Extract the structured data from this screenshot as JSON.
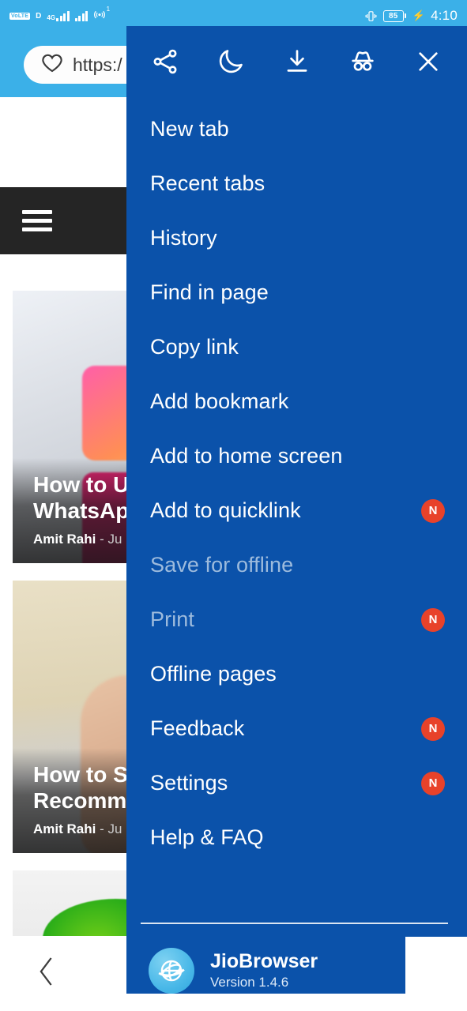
{
  "status_bar": {
    "volte_label": "VoLTE",
    "data_letter": "D",
    "network_label": "4G",
    "hotspot_sup": "1",
    "battery_level": "85",
    "time": "4:10",
    "icons": [
      "volte-icon",
      "signal-bars-icon",
      "signal-bars-icon",
      "hotspot-icon",
      "vibrate-icon",
      "battery-icon",
      "charging-bolt-icon"
    ]
  },
  "browser": {
    "url_text": "https:/",
    "favorite_icon": "heart-icon",
    "menu_icon": "hamburger-icon",
    "back_icon": "chevron-left-icon"
  },
  "articles": [
    {
      "title_line1": "How to U",
      "title_line2": "WhatsApp",
      "author": "Amit Rahi",
      "separator": "-",
      "date": "Ju"
    },
    {
      "title_line1": "How to S",
      "title_line2": "Recomme",
      "author": "Amit Rahi",
      "separator": "-",
      "date": "Ju"
    }
  ],
  "menu": {
    "top_icons": [
      {
        "name": "share-icon",
        "label": "Share"
      },
      {
        "name": "night-mode-icon",
        "label": "Night mode"
      },
      {
        "name": "downloads-icon",
        "label": "Downloads"
      },
      {
        "name": "incognito-icon",
        "label": "Incognito"
      },
      {
        "name": "close-icon",
        "label": "Close"
      }
    ],
    "items": [
      {
        "label": "New tab",
        "badge": "",
        "disabled": false
      },
      {
        "label": "Recent tabs",
        "badge": "",
        "disabled": false
      },
      {
        "label": "History",
        "badge": "",
        "disabled": false
      },
      {
        "label": "Find in page",
        "badge": "",
        "disabled": false
      },
      {
        "label": "Copy link",
        "badge": "",
        "disabled": false
      },
      {
        "label": "Add bookmark",
        "badge": "",
        "disabled": false
      },
      {
        "label": "Add to home screen",
        "badge": "",
        "disabled": false
      },
      {
        "label": "Add to quicklink",
        "badge": "N",
        "disabled": false
      },
      {
        "label": "Save for offline",
        "badge": "",
        "disabled": true
      },
      {
        "label": "Print",
        "badge": "N",
        "disabled": true
      },
      {
        "label": "Offline pages",
        "badge": "",
        "disabled": false
      },
      {
        "label": "Feedback",
        "badge": "N",
        "disabled": false
      },
      {
        "label": "Settings",
        "badge": "N",
        "disabled": false
      },
      {
        "label": "Help & FAQ",
        "badge": "",
        "disabled": false
      }
    ],
    "footer": {
      "logo_icon": "globe-icon",
      "app_name": "JioBrowser",
      "version": "Version 1.4.6"
    }
  },
  "colors": {
    "status_bar": "#3bb0e8",
    "menu_panel": "#0b52aa",
    "badge": "#e8422a",
    "site_header": "#252525",
    "disabled_text": "#9dbbdd"
  }
}
